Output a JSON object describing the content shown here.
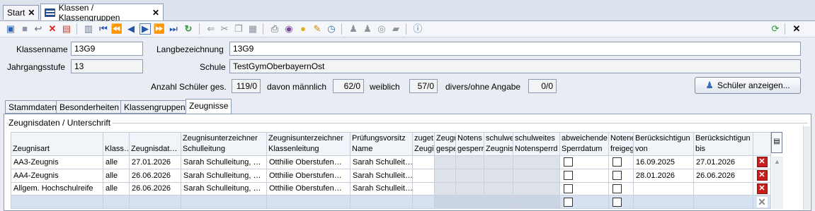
{
  "tabs": [
    {
      "label": "Start",
      "close": "✕"
    },
    {
      "label": "Klassen / Klassengruppen",
      "close": "✕"
    }
  ],
  "toolbar": {
    "close_label": "✕"
  },
  "form": {
    "klassenname_label": "Klassenname",
    "klassenname_value": "13G9",
    "langbez_label": "Langbezeichnung",
    "langbez_value": "13G9",
    "jahrgang_label": "Jahrgangsstufe",
    "jahrgang_value": "13",
    "schule_label": "Schule",
    "schule_value": "TestGymOberbayernOst",
    "anzahl_label": "Anzahl Schüler ges.",
    "anzahl_value": "119/0",
    "maennlich_label": "davon männlich",
    "maennlich_value": "62/0",
    "weiblich_label": "weiblich",
    "weiblich_value": "57/0",
    "divers_label": "divers/ohne Angabe",
    "divers_value": "0/0",
    "schueler_button": "Schüler anzeigen..."
  },
  "subtabs": [
    "Stammdaten",
    "Besonderheiten",
    "Klassengruppen",
    "Zeugnisse"
  ],
  "section_title": "Zeugnisdaten / Unterschrift",
  "grid": {
    "headers": [
      [
        "Zeugnisart",
        ""
      ],
      [
        "Klass…",
        ""
      ],
      [
        "Zeugnisdat…",
        ""
      ],
      [
        "Zeugnisunterzeichner",
        "Schulleitung"
      ],
      [
        "Zeugnisunterzeichner",
        "Klassenleitung"
      ],
      [
        "Prüfungsvorsitz",
        "Name"
      ],
      [
        "zuget",
        "Zeugi"
      ],
      [
        "Zeugr",
        "gespe"
      ],
      [
        "Notens",
        "gesperr"
      ],
      [
        "schulwe",
        "Zeugnis"
      ],
      [
        "schulweites",
        "Notensperrd"
      ],
      [
        "abweichende",
        "Sperrdatum"
      ],
      [
        "Notene",
        "freigeg"
      ],
      [
        "Berücksichtigun",
        "von"
      ],
      [
        "Berücksichtigun",
        "bis"
      ]
    ],
    "rows": [
      {
        "art": "AA3-Zeugnis",
        "klasse": "alle",
        "datum": "27.01.2026",
        "sl": "Sarah Schulleitung, …",
        "kl": "Otthilie Oberstufen…",
        "pv": "Sarah Schulleit…",
        "von": "16.09.2025",
        "bis": "27.01.2026"
      },
      {
        "art": "AA4-Zeugnis",
        "klasse": "alle",
        "datum": "26.06.2026",
        "sl": "Sarah Schulleitung, …",
        "kl": "Otthilie Oberstufen…",
        "pv": "Sarah Schulleit…",
        "von": "28.01.2026",
        "bis": "26.06.2026"
      },
      {
        "art": "Allgem. Hochschulreife",
        "klasse": "alle",
        "datum": "26.06.2026",
        "sl": "Sarah Schulleitung, …",
        "kl": "Otthilie Oberstufen…",
        "pv": "Sarah Schulleit…",
        "von": "",
        "bis": ""
      },
      {
        "art": "",
        "klasse": "",
        "datum": "",
        "sl": "",
        "kl": "",
        "pv": "",
        "von": "",
        "bis": ""
      }
    ],
    "delete_icon": "✕"
  }
}
